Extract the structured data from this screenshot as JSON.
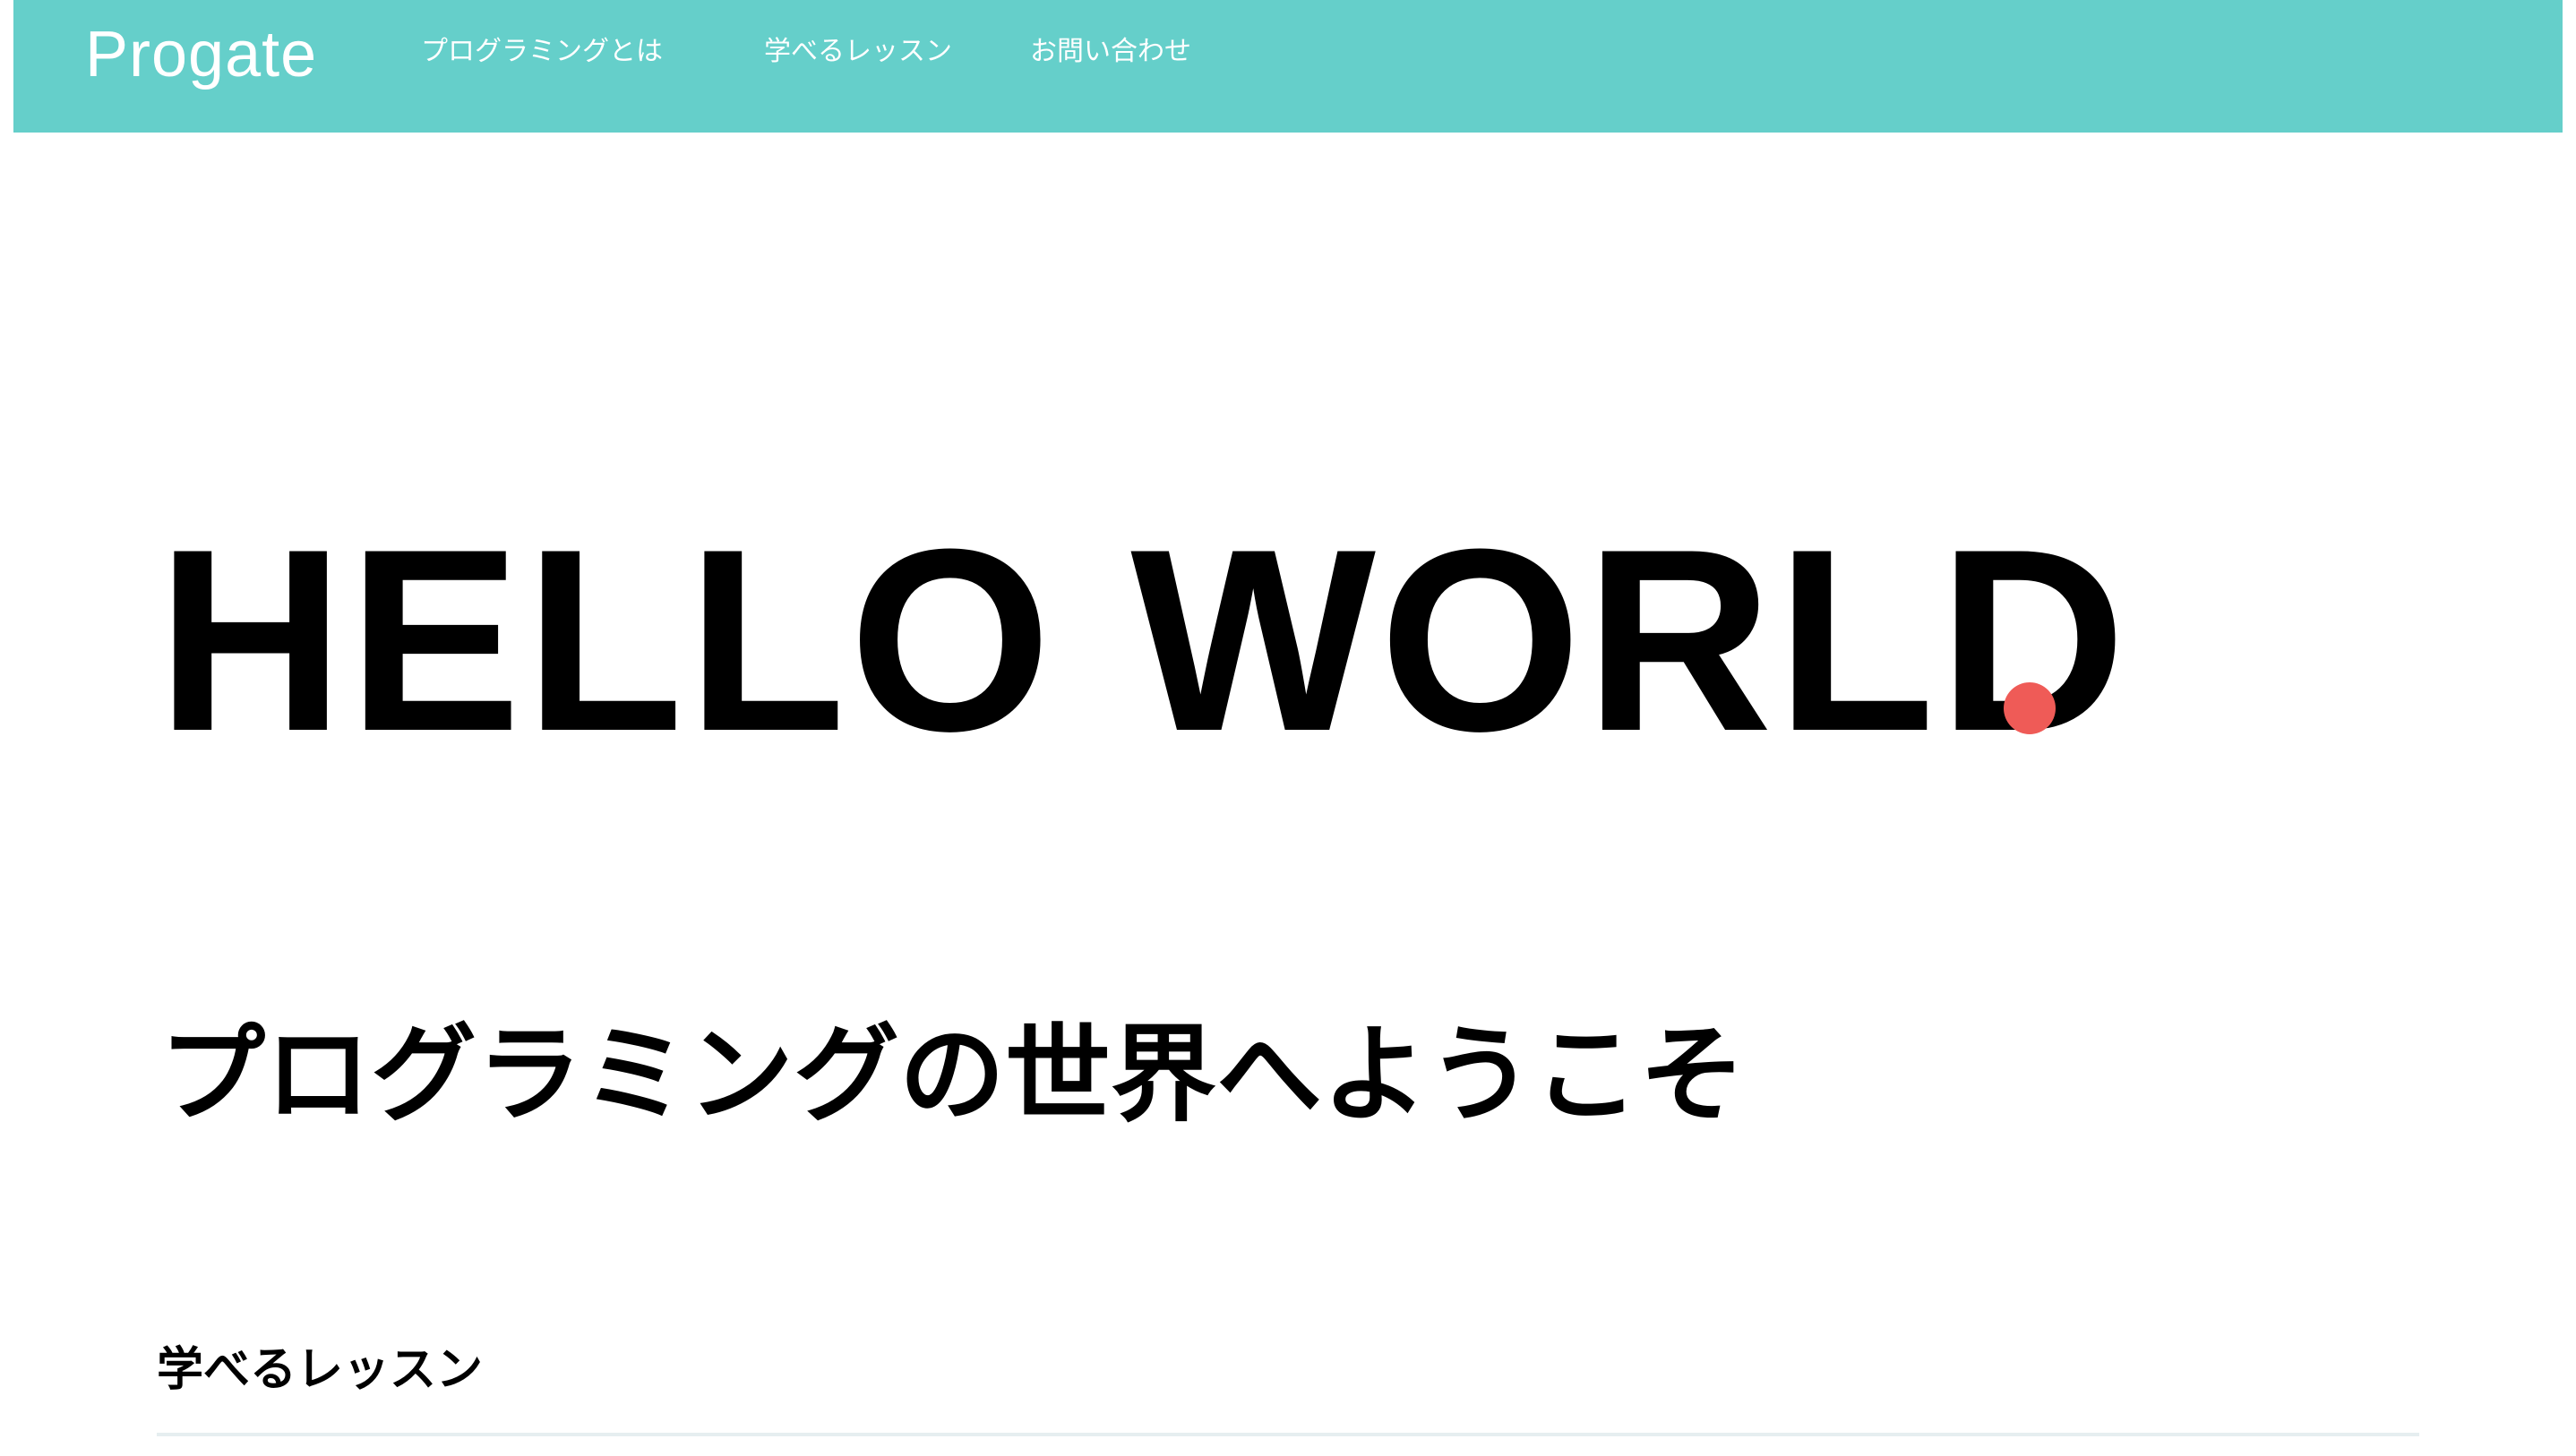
{
  "header": {
    "logo": "Progate",
    "nav": [
      {
        "label": "プログラミングとは"
      },
      {
        "label": "学べるレッスン"
      },
      {
        "label": "お問い合わせ"
      }
    ],
    "background_color": "#65cfca"
  },
  "hero": {
    "title": "HELLO WORLD",
    "dot_color": "#ef5b57",
    "subtitle": "プログラミングの世界へようこそ"
  },
  "lessons": {
    "heading": "学べるレッスン"
  }
}
